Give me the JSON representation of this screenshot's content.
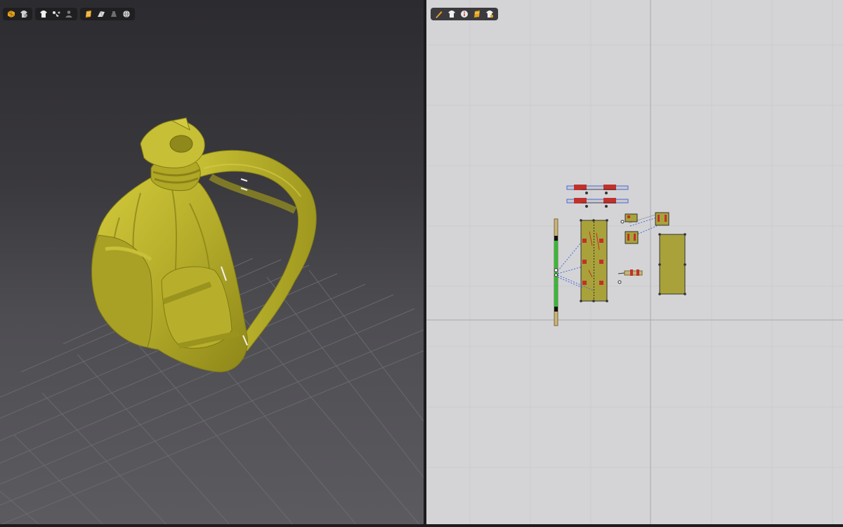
{
  "app": {
    "accent_color": "#e8a21a",
    "garment_color": "#b5ad2a",
    "panel_fill_color": "#a9a23a",
    "seam_blue": "#4a68d8",
    "seam_green": "#38b73a",
    "pin_red": "#c0312b"
  },
  "viewport_3d": {
    "toolbar_groups": [
      {
        "name": "simulation-group",
        "icons": [
          "simulate-icon",
          "avatar-garment-icon"
        ]
      },
      {
        "name": "display-group",
        "icons": [
          "garment-icon",
          "fold-arrangement-icon",
          "avatar-icon"
        ]
      },
      {
        "name": "render-group",
        "icons": [
          "texture-icon",
          "surface-icon",
          "hanger-icon",
          "sphere-icon"
        ]
      }
    ]
  },
  "viewport_2d": {
    "toolbar_groups": [
      {
        "name": "pattern-tools-group",
        "icons": [
          "edit-pattern-icon",
          "garment-icon",
          "texture-info-icon",
          "thickness-icon",
          "garment-settings-icon"
        ]
      }
    ]
  }
}
